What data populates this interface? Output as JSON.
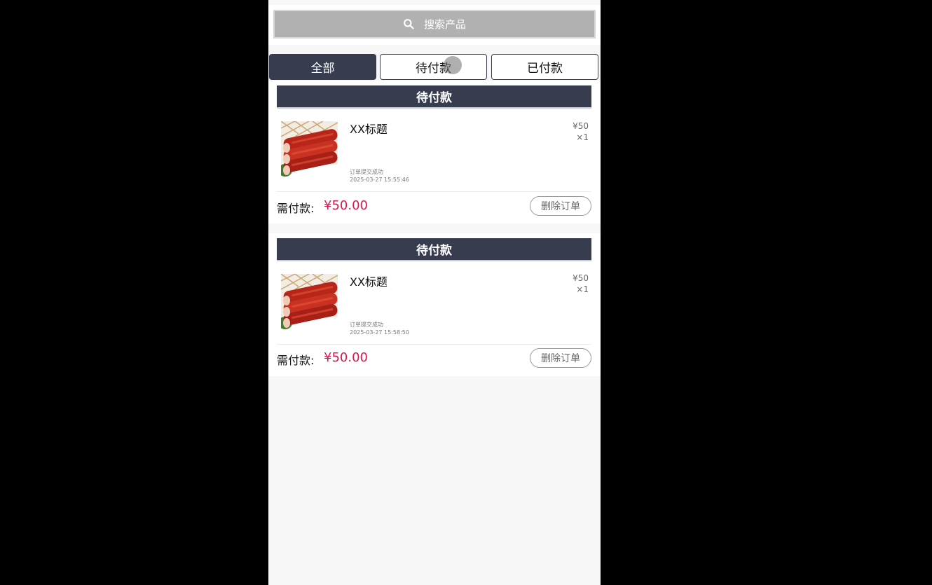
{
  "search": {
    "placeholder": "搜索产品",
    "icon": "search-icon"
  },
  "tabs": [
    {
      "label": "全部",
      "active": true
    },
    {
      "label": "待付款",
      "active": false
    },
    {
      "label": "已付款",
      "active": false
    }
  ],
  "orders": [
    {
      "status_header": "待付款",
      "item_title": "XX标题",
      "unit_price": "¥50",
      "quantity": "×1",
      "status_text": "订单提交成功",
      "timestamp": "2025-03-27 15:55:46",
      "pay_label": "需付款:",
      "pay_amount": "¥50.00",
      "delete_label": "删除订单"
    },
    {
      "status_header": "待付款",
      "item_title": "XX标题",
      "unit_price": "¥50",
      "quantity": "×1",
      "status_text": "订单提交成功",
      "timestamp": "2025-03-27 15:58:50",
      "pay_label": "需付款:",
      "pay_amount": "¥50.00",
      "delete_label": "删除订单"
    }
  ],
  "colors": {
    "header_bg": "#373d4f",
    "price_accent": "#d6184a",
    "search_bg": "#b1b1b1"
  }
}
